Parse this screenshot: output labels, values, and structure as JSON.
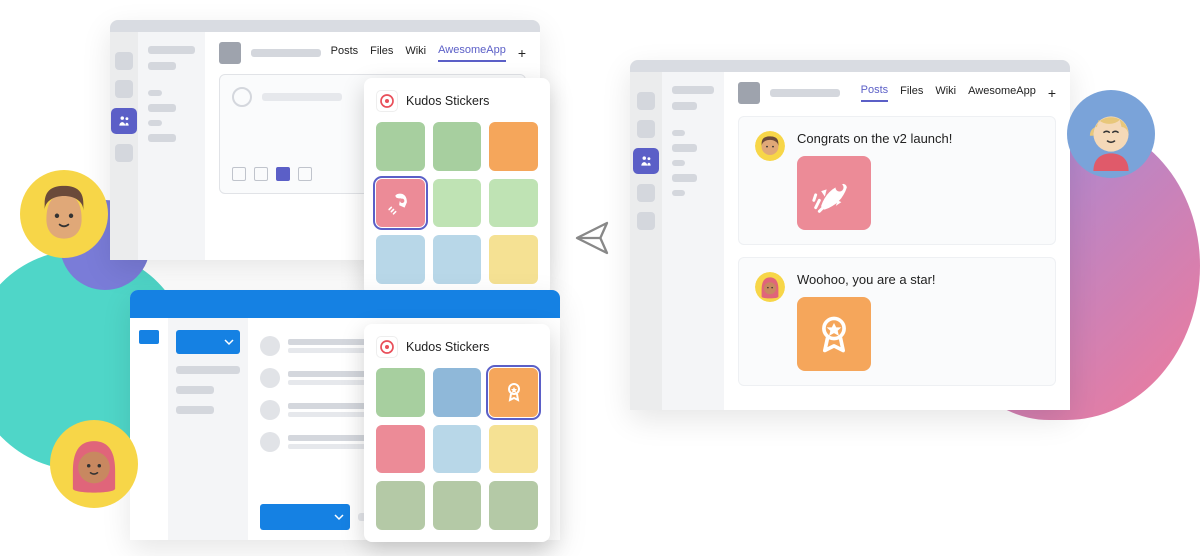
{
  "tabs": {
    "posts": "Posts",
    "files": "Files",
    "wiki": "Wiki",
    "awesomeapp": "AwesomeApp"
  },
  "sticker_popup": {
    "title": "Kudos Stickers",
    "grid1_selected_icon": "rocket-icon",
    "grid2_selected_icon": "award-ribbon-icon"
  },
  "result": {
    "post1_text": "Congrats on the v2 launch!",
    "post1_sticker": "rocket-icon",
    "post2_text": "Woohoo, you are a star!",
    "post2_sticker": "award-ribbon-icon"
  }
}
